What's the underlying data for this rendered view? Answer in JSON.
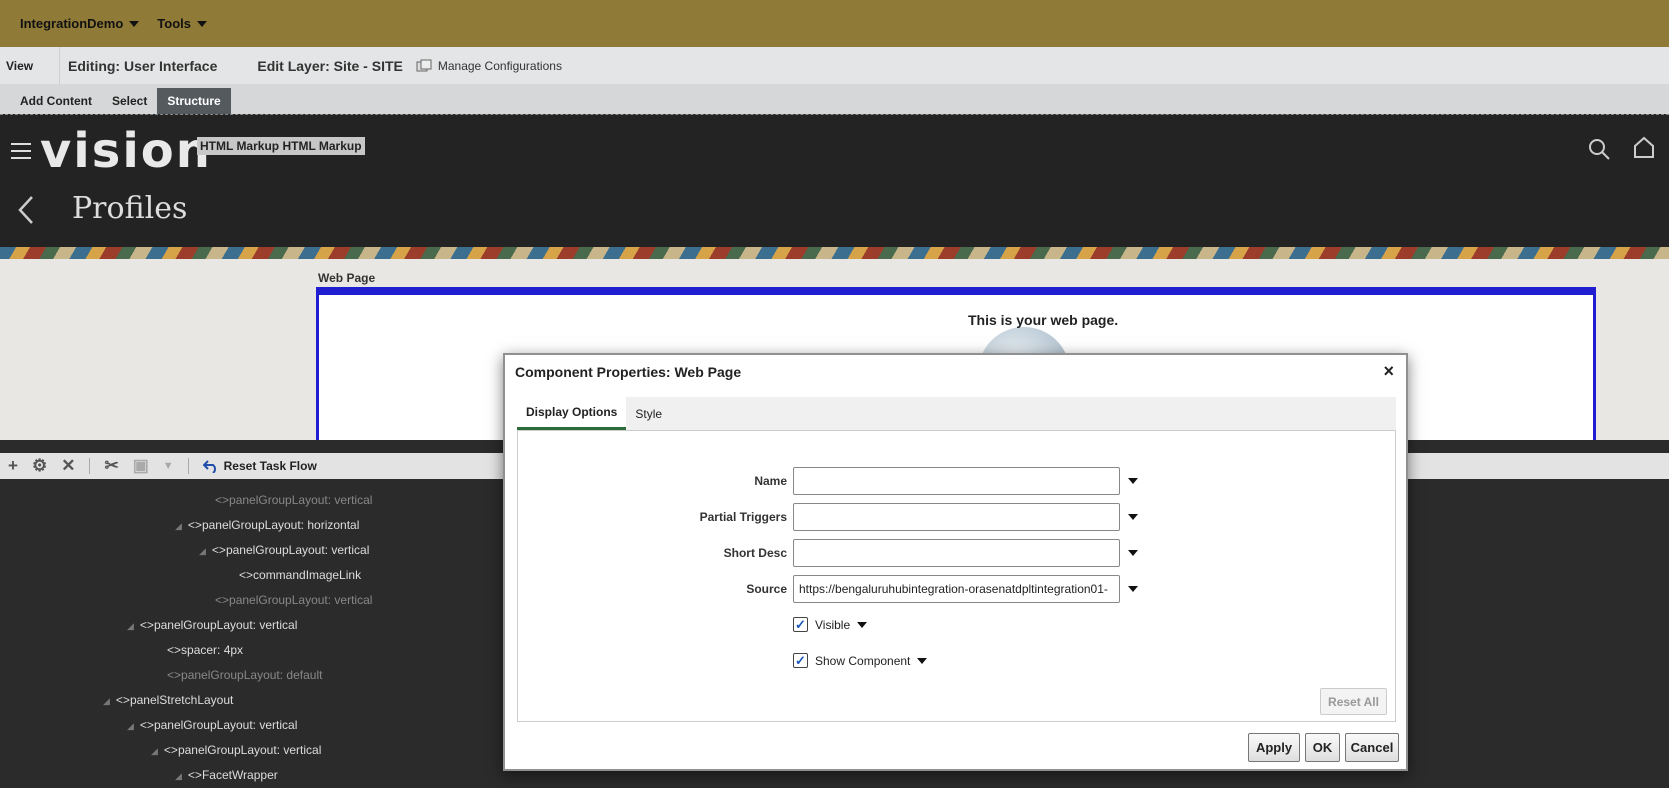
{
  "topbar": {
    "menu1": "IntegrationDemo",
    "menu2": "Tools"
  },
  "editbar": {
    "view": "View",
    "editing": "Editing: User Interface",
    "layer": "Edit Layer: Site - SITE",
    "manage": "Manage Configurations"
  },
  "modebar": {
    "tabs": [
      "Add Content",
      "Select",
      "Structure"
    ]
  },
  "app": {
    "logo": "vision",
    "markup": "HTML Markup HTML Markup",
    "title": "Profiles"
  },
  "content": {
    "label": "Web Page",
    "text": "This is your web page."
  },
  "toolbar": {
    "reset": "Reset Task Flow"
  },
  "tree": [
    "panelGroupLayout: vertical",
    "panelGroupLayout: horizontal",
    "panelGroupLayout: vertical",
    "commandImageLink",
    "panelGroupLayout: vertical",
    "panelGroupLayout: vertical",
    "spacer: 4px",
    "panelGroupLayout: default",
    "panelStretchLayout",
    "panelGroupLayout: vertical",
    "panelGroupLayout: vertical",
    "FacetWrapper"
  ],
  "dialog": {
    "title": "Component Properties: Web Page",
    "close": "×",
    "tabs": [
      "Display Options",
      "Style"
    ],
    "fields": {
      "name_label": "Name",
      "name_value": "",
      "partial_label": "Partial Triggers",
      "partial_value": "",
      "short_label": "Short Desc",
      "short_value": "",
      "source_label": "Source",
      "source_value": "https://bengaluruhubintegration-orasenatdpltintegration01-"
    },
    "visible": "Visible",
    "show": "Show Component",
    "reset_all": "Reset All",
    "apply": "Apply",
    "ok": "OK",
    "cancel": "Cancel"
  }
}
